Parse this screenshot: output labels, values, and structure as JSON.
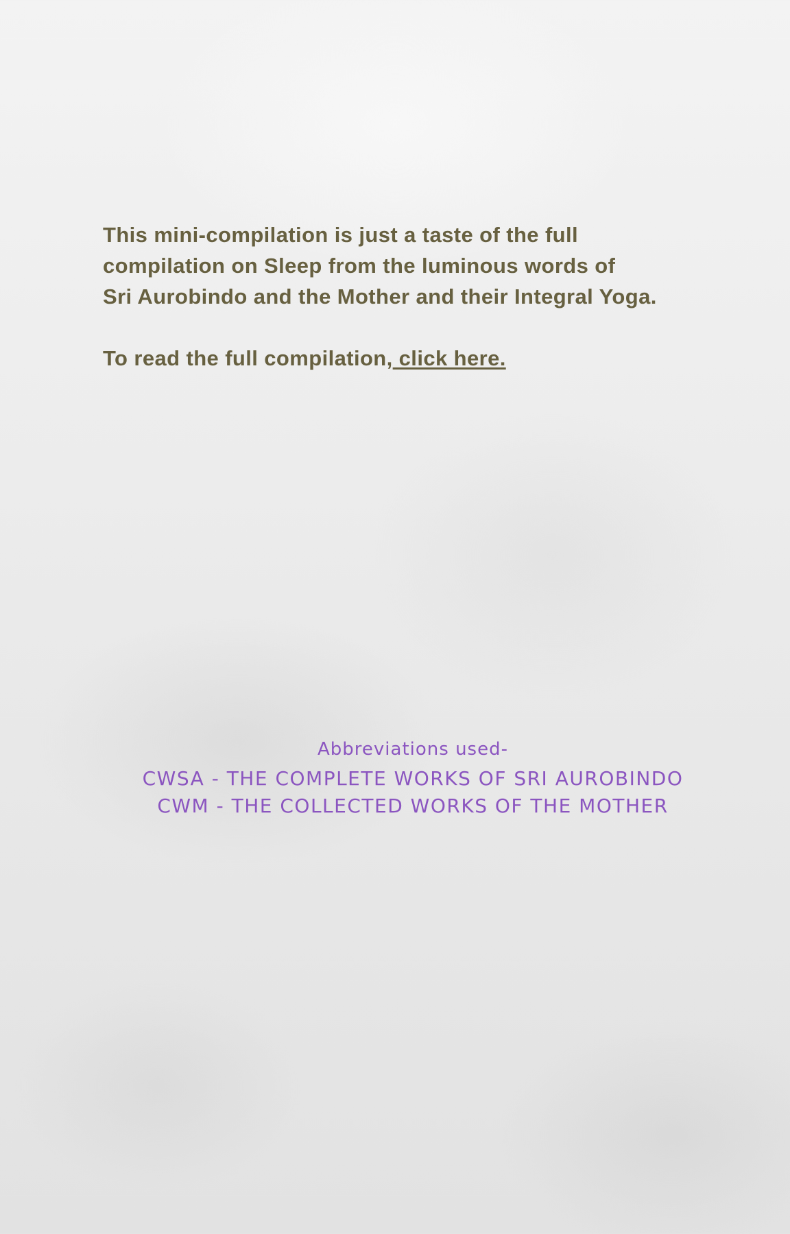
{
  "intro": {
    "paragraph_lines": [
      "This mini-compilation is just a taste of the full",
      "compilation on Sleep from the luminous words of",
      "Sri Aurobindo and the Mother and their Integral Yoga."
    ],
    "read_prefix": "To read the full compilation,",
    "link_text": " click here."
  },
  "abbreviations": {
    "heading": "Abbreviations used-",
    "items": [
      "CWSA - THE COMPLETE WORKS OF SRI AUROBINDO",
      "CWM - THE COLLECTED WORKS OF THE MOTHER"
    ]
  },
  "colors": {
    "body_text": "#676040",
    "accent": "#8b55c0"
  }
}
